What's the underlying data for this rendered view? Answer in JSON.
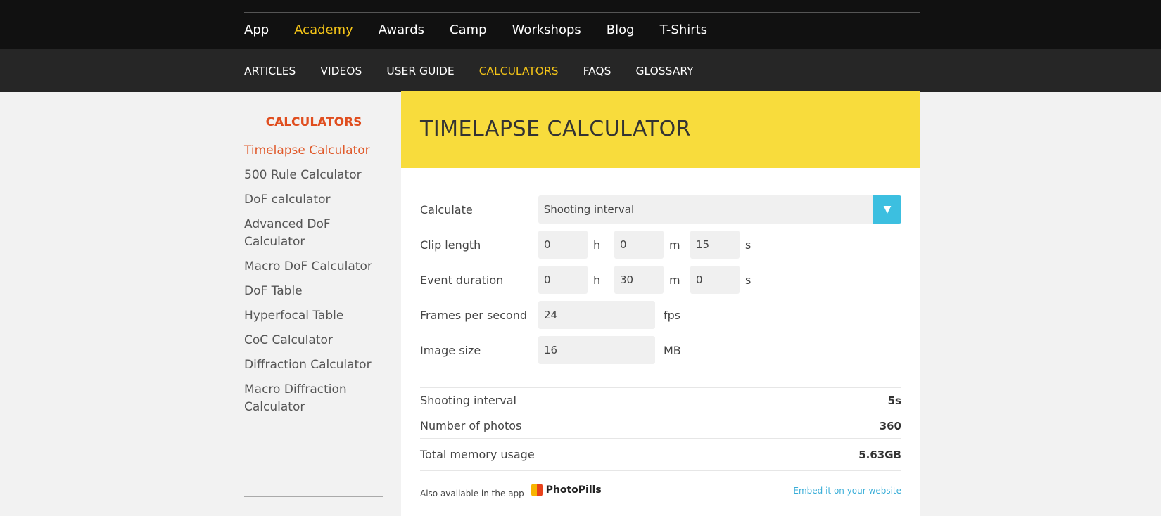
{
  "top_nav": [
    "App",
    "Academy",
    "Awards",
    "Camp",
    "Workshops",
    "Blog",
    "T-Shirts"
  ],
  "sub_nav": [
    "ARTICLES",
    "VIDEOS",
    "USER GUIDE",
    "CALCULATORS",
    "FAQS",
    "GLOSSARY"
  ],
  "sidebar": {
    "title": "CALCULATORS",
    "items": [
      "Timelapse Calculator",
      "500 Rule Calculator",
      "DoF calculator",
      "Advanced DoF Calculator",
      "Macro DoF Calculator",
      "DoF Table",
      "Hyperfocal Table",
      "CoC Calculator",
      "Diffraction Calculator",
      "Macro Diffraction Calculator"
    ]
  },
  "panel": {
    "title": "TIMELAPSE CALCULATOR",
    "calculate": {
      "label": "Calculate",
      "value": "Shooting interval"
    },
    "clip": {
      "label": "Clip length",
      "h": "0",
      "m": "0",
      "s": "15"
    },
    "event": {
      "label": "Event duration",
      "h": "0",
      "m": "30",
      "s": "0"
    },
    "fps": {
      "label": "Frames per second",
      "value": "24",
      "unit": "fps"
    },
    "size": {
      "label": "Image size",
      "value": "16",
      "unit": "MB"
    },
    "units": {
      "h": "h",
      "m": "m",
      "s": "s"
    },
    "results": [
      {
        "label": "Shooting interval",
        "value": "5s"
      },
      {
        "label": "Number of photos",
        "value": "360"
      },
      {
        "label": "Total memory usage",
        "value": "5.63GB"
      }
    ],
    "footer": {
      "available": "Also available in the app",
      "app": "PhotoPills",
      "embed": "Embed it on your website"
    }
  }
}
